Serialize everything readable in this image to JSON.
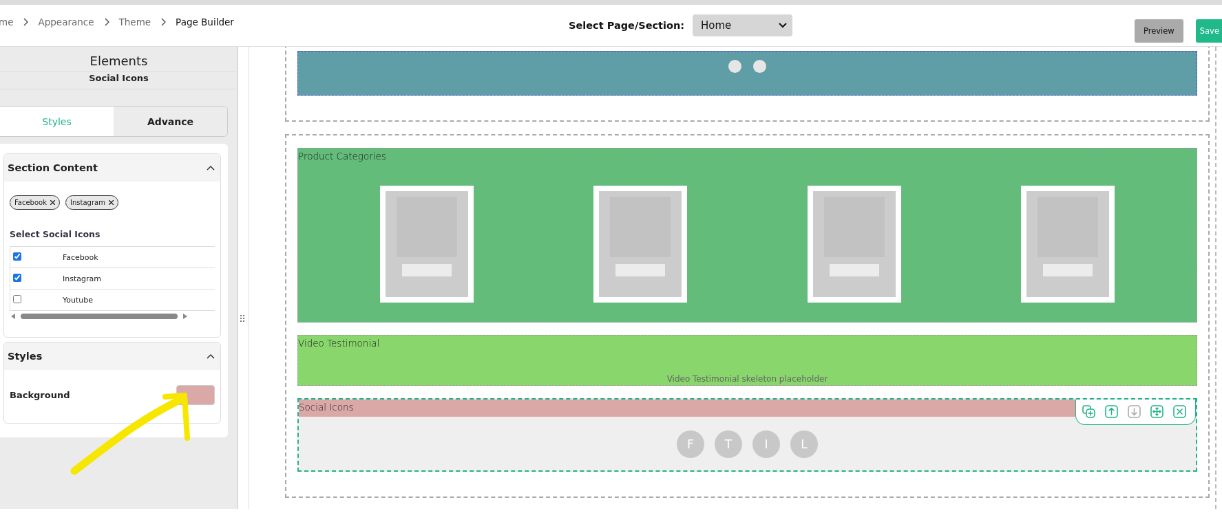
{
  "breadcrumb": [
    "me",
    "Appearance",
    "Theme",
    "Page Builder"
  ],
  "page_select": {
    "label": "Select Page/Section:",
    "value": "Home"
  },
  "buttons": [
    {
      "label": "Preview",
      "kind": "secondary"
    },
    {
      "label": "Save",
      "kind": "primary"
    }
  ],
  "panel": {
    "title": "Elements",
    "subtitle": "Social Icons",
    "tabs": [
      {
        "label": "Styles",
        "selected": true
      },
      {
        "label": "Advance",
        "selected": false
      }
    ],
    "section_content": {
      "title": "Section Content",
      "expanded": true,
      "chips": [
        "Facebook",
        "Instagram"
      ],
      "list_label": "Select Social Icons",
      "options": [
        {
          "label": "Facebook",
          "checked": true
        },
        {
          "label": "Instagram",
          "checked": true
        },
        {
          "label": "Youtube",
          "checked": false
        }
      ]
    },
    "styles": {
      "title": "Styles",
      "expanded": true,
      "background": {
        "label": "Background",
        "color": "#dba8a8"
      }
    }
  },
  "canvas": {
    "sections": [
      {
        "blocks": [
          {
            "kind": "banner",
            "color": "#5f9ea6"
          }
        ]
      },
      {
        "blocks": [
          {
            "kind": "products",
            "title": "Product Categories",
            "color": "#63bc7a"
          },
          {
            "kind": "video",
            "title": "Video Testimonial",
            "color": "#88d66c",
            "placeholder": "Video Testimonial skeleton placeholder"
          },
          {
            "kind": "social",
            "title": "Social Icons",
            "selected": true,
            "icons": [
              "F",
              "T",
              "I",
              "L"
            ],
            "toolbar": [
              {
                "kind": "duplicate",
                "disabled": false
              },
              {
                "kind": "up",
                "disabled": false
              },
              {
                "kind": "down",
                "disabled": true
              },
              {
                "kind": "move",
                "disabled": false
              },
              {
                "kind": "delete",
                "disabled": false
              }
            ]
          }
        ]
      }
    ]
  }
}
